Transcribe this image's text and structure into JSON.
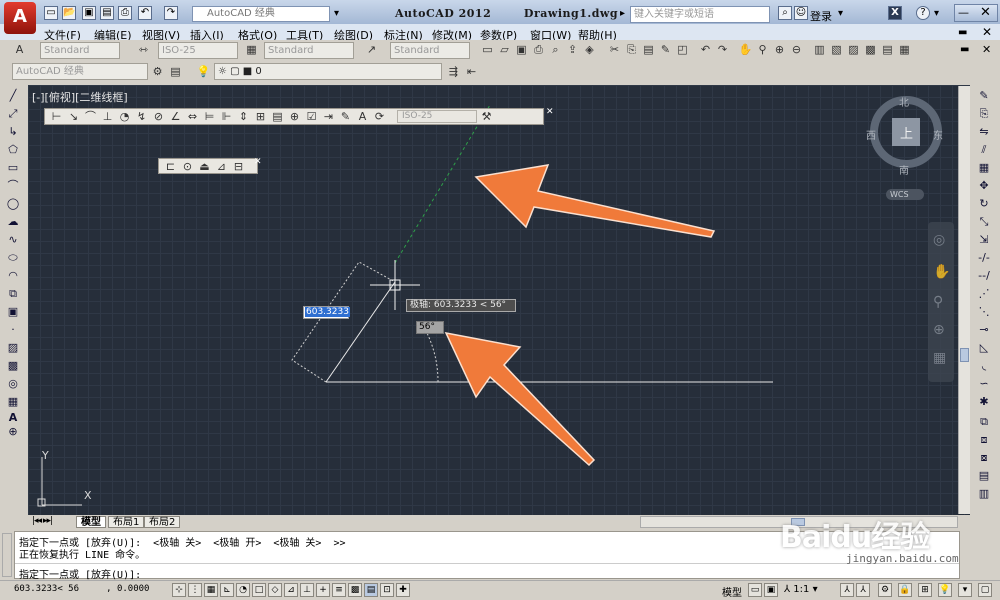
{
  "title": {
    "app_name": "AutoCAD 2012",
    "file_name": "Drawing1.dwg",
    "app_icon": "A",
    "workspace": "AutoCAD 经典",
    "search_placeholder": "键入关键字或短语",
    "login": "登录"
  },
  "menu": [
    "文件(F)",
    "编辑(E)",
    "视图(V)",
    "插入(I)",
    "格式(O)",
    "工具(T)",
    "绘图(D)",
    "标注(N)",
    "修改(M)",
    "参数(P)",
    "窗口(W)",
    "帮助(H)"
  ],
  "styles": {
    "text_style": "Standard",
    "dim_style": "ISO-25",
    "table_style": "Standard",
    "multileader_style": "Standard",
    "workspace2": "AutoCAD 经典",
    "layer": "0"
  },
  "canvas": {
    "view_label": "[-][俯视][二维线框]",
    "viewcube": {
      "north": "北",
      "south": "南",
      "east": "东",
      "west": "西",
      "top": "上",
      "wcs": "WCS"
    },
    "dim_toolbar_style": "ISO-25",
    "input_value": "603.3233",
    "tooltip": "极轴: 603.3233 < 56°",
    "angle_value": "56°",
    "ucs_y": "Y",
    "ucs_x": "X"
  },
  "tabs": [
    "模型",
    "布局1",
    "布局2"
  ],
  "command": {
    "line1": "指定下一点或 [放弃(U)]:  <极轴 关>  <极轴 开>  <极轴 关>  >>",
    "line2": "正在恢复执行 LINE 命令。",
    "prompt": "指定下一点或 [放弃(U)]:"
  },
  "status": {
    "coords": "603.3233< 56     , 0.0000",
    "model": "模型",
    "scale": "1:1"
  },
  "watermark": {
    "text": "Baidu经验",
    "url": "jingyan.baidu.com"
  },
  "colors": {
    "canvas_bg": "#262e3a",
    "arrow": "#f07a3a",
    "polar_track": "#2ea04a",
    "line": "#e8e8e8"
  }
}
